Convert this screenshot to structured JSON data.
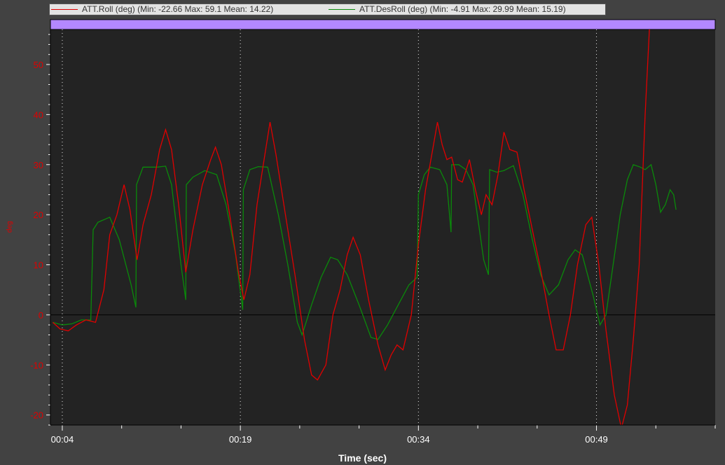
{
  "legend": {
    "roll_label": "ATT.Roll (deg)  (Min: -22.66 Max: 59.1 Mean: 14.22)",
    "desroll_label": "ATT.DesRoll (deg)  (Min: -4.91 Max: 29.99 Mean: 15.19)"
  },
  "chart_data": {
    "type": "line",
    "xlabel": "Time (sec)",
    "ylabel": "deg",
    "xticks": [
      "00:04",
      "00:19",
      "00:34",
      "00:49"
    ],
    "xtick_seconds": [
      4,
      19,
      34,
      49
    ],
    "xlim": [
      3,
      59
    ],
    "ylim": [
      -22,
      57
    ],
    "yticks": [
      -20,
      -10,
      0,
      10,
      20,
      30,
      40,
      50
    ],
    "grid": "vertical dotted at major ticks",
    "legend_position": "top",
    "colors": {
      "roll": "#e00000",
      "desroll": "#0a8a0a",
      "background": "#232323",
      "event_band": "#b388ff"
    },
    "series": [
      {
        "name": "ATT.Roll (deg)",
        "stats": {
          "min": -22.66,
          "max": 59.1,
          "mean": 14.22
        },
        "points": [
          [
            3.2,
            -1.5
          ],
          [
            3.8,
            -2.8
          ],
          [
            4.5,
            -3.2
          ],
          [
            5.2,
            -2
          ],
          [
            6,
            -1
          ],
          [
            6.8,
            -1.5
          ],
          [
            7.5,
            5
          ],
          [
            8,
            16
          ],
          [
            8.6,
            20
          ],
          [
            9.2,
            26
          ],
          [
            9.7,
            21
          ],
          [
            10.3,
            11
          ],
          [
            10.8,
            18
          ],
          [
            11.5,
            24
          ],
          [
            12.2,
            33
          ],
          [
            12.7,
            37
          ],
          [
            13.2,
            33
          ],
          [
            13.8,
            22
          ],
          [
            14.4,
            8.5
          ],
          [
            15,
            17
          ],
          [
            15.8,
            26
          ],
          [
            16.5,
            31
          ],
          [
            16.9,
            33.5
          ],
          [
            17.4,
            30
          ],
          [
            18.1,
            20
          ],
          [
            18.8,
            9
          ],
          [
            19.3,
            3
          ],
          [
            19.8,
            8
          ],
          [
            20.4,
            22
          ],
          [
            21,
            31
          ],
          [
            21.5,
            38.5
          ],
          [
            22,
            32
          ],
          [
            22.8,
            20
          ],
          [
            23.6,
            8
          ],
          [
            24.4,
            -5
          ],
          [
            25,
            -12
          ],
          [
            25.5,
            -13
          ],
          [
            26.2,
            -10
          ],
          [
            26.8,
            0
          ],
          [
            27.4,
            5
          ],
          [
            28,
            12
          ],
          [
            28.5,
            15.5
          ],
          [
            29.1,
            12
          ],
          [
            29.8,
            3
          ],
          [
            30.6,
            -6
          ],
          [
            31.2,
            -11
          ],
          [
            31.7,
            -8
          ],
          [
            32.2,
            -6
          ],
          [
            32.7,
            -7
          ],
          [
            33.4,
            0
          ],
          [
            34,
            14
          ],
          [
            34.6,
            25
          ],
          [
            35.2,
            33
          ],
          [
            35.6,
            38.5
          ],
          [
            36,
            34
          ],
          [
            36.4,
            31
          ],
          [
            36.8,
            31.5
          ],
          [
            37.3,
            27
          ],
          [
            37.7,
            26.5
          ],
          [
            38.3,
            31
          ],
          [
            38.8,
            25
          ],
          [
            39.3,
            20
          ],
          [
            39.7,
            24
          ],
          [
            40.2,
            22
          ],
          [
            40.7,
            28
          ],
          [
            41.2,
            36.5
          ],
          [
            41.7,
            33
          ],
          [
            42.3,
            32.5
          ],
          [
            42.9,
            25
          ],
          [
            43.6,
            17
          ],
          [
            44.3,
            9
          ],
          [
            45,
            0
          ],
          [
            45.6,
            -7
          ],
          [
            46.2,
            -7
          ],
          [
            46.8,
            0
          ],
          [
            47.4,
            10
          ],
          [
            48.1,
            18
          ],
          [
            48.6,
            19.5
          ],
          [
            49.2,
            10
          ],
          [
            49.8,
            -3
          ],
          [
            50.5,
            -16
          ],
          [
            51.1,
            -22.66
          ],
          [
            51.6,
            -18
          ],
          [
            52.1,
            -5
          ],
          [
            52.6,
            10
          ],
          [
            53.1,
            40
          ],
          [
            53.5,
            59.1
          ]
        ]
      },
      {
        "name": "ATT.DesRoll (deg)",
        "stats": {
          "min": -4.91,
          "max": 29.99,
          "mean": 15.19
        },
        "points": [
          [
            3.2,
            -1.5
          ],
          [
            4,
            -2
          ],
          [
            4.8,
            -1.8
          ],
          [
            5.6,
            -1
          ],
          [
            6.4,
            -1
          ],
          [
            6.6,
            17
          ],
          [
            7,
            18.5
          ],
          [
            8,
            19.5
          ],
          [
            8.8,
            15
          ],
          [
            9.8,
            6
          ],
          [
            10.2,
            1.5
          ],
          [
            10.25,
            26
          ],
          [
            10.8,
            29.5
          ],
          [
            12,
            29.5
          ],
          [
            12.7,
            29.7
          ],
          [
            13.2,
            26
          ],
          [
            14,
            10
          ],
          [
            14.4,
            3
          ],
          [
            14.45,
            26
          ],
          [
            15,
            27.5
          ],
          [
            16,
            28.8
          ],
          [
            17,
            28
          ],
          [
            17.8,
            22
          ],
          [
            18.6,
            12
          ],
          [
            19.2,
            1
          ],
          [
            19.25,
            25
          ],
          [
            19.8,
            29
          ],
          [
            20.5,
            29.6
          ],
          [
            21.3,
            29.5
          ],
          [
            22.2,
            20
          ],
          [
            23,
            10
          ],
          [
            23.8,
            -1.5
          ],
          [
            24.2,
            -4
          ],
          [
            25,
            2
          ],
          [
            25.8,
            7.5
          ],
          [
            26.6,
            11.5
          ],
          [
            27.2,
            11
          ],
          [
            28,
            8
          ],
          [
            29,
            2
          ],
          [
            30,
            -4.5
          ],
          [
            30.6,
            -4.91
          ],
          [
            31.4,
            -2
          ],
          [
            32.3,
            2
          ],
          [
            33.2,
            6
          ],
          [
            33.9,
            7.5
          ],
          [
            34,
            24
          ],
          [
            34.5,
            28
          ],
          [
            35,
            29.5
          ],
          [
            35.8,
            29
          ],
          [
            36.4,
            26
          ],
          [
            36.75,
            16.5
          ],
          [
            36.8,
            30
          ],
          [
            37.4,
            30
          ],
          [
            38,
            29
          ],
          [
            38.6,
            26
          ],
          [
            39.5,
            11
          ],
          [
            39.9,
            8
          ],
          [
            40,
            29
          ],
          [
            40.6,
            28.5
          ],
          [
            41.2,
            28.8
          ],
          [
            42,
            29.8
          ],
          [
            42.8,
            24
          ],
          [
            43.6,
            15
          ],
          [
            44.3,
            8
          ],
          [
            45,
            4
          ],
          [
            45.8,
            6
          ],
          [
            46.6,
            11
          ],
          [
            47.2,
            13
          ],
          [
            47.8,
            12
          ],
          [
            48.7,
            4
          ],
          [
            49.3,
            -2
          ],
          [
            49.8,
            0
          ],
          [
            50.4,
            10
          ],
          [
            51,
            20
          ],
          [
            51.6,
            27
          ],
          [
            52.1,
            30
          ],
          [
            52.7,
            29.5
          ],
          [
            53.1,
            29
          ],
          [
            53.6,
            30
          ],
          [
            54,
            26
          ],
          [
            54.4,
            20.5
          ],
          [
            54.8,
            22
          ],
          [
            55.2,
            25
          ],
          [
            55.5,
            24
          ],
          [
            55.7,
            21
          ]
        ]
      }
    ]
  }
}
